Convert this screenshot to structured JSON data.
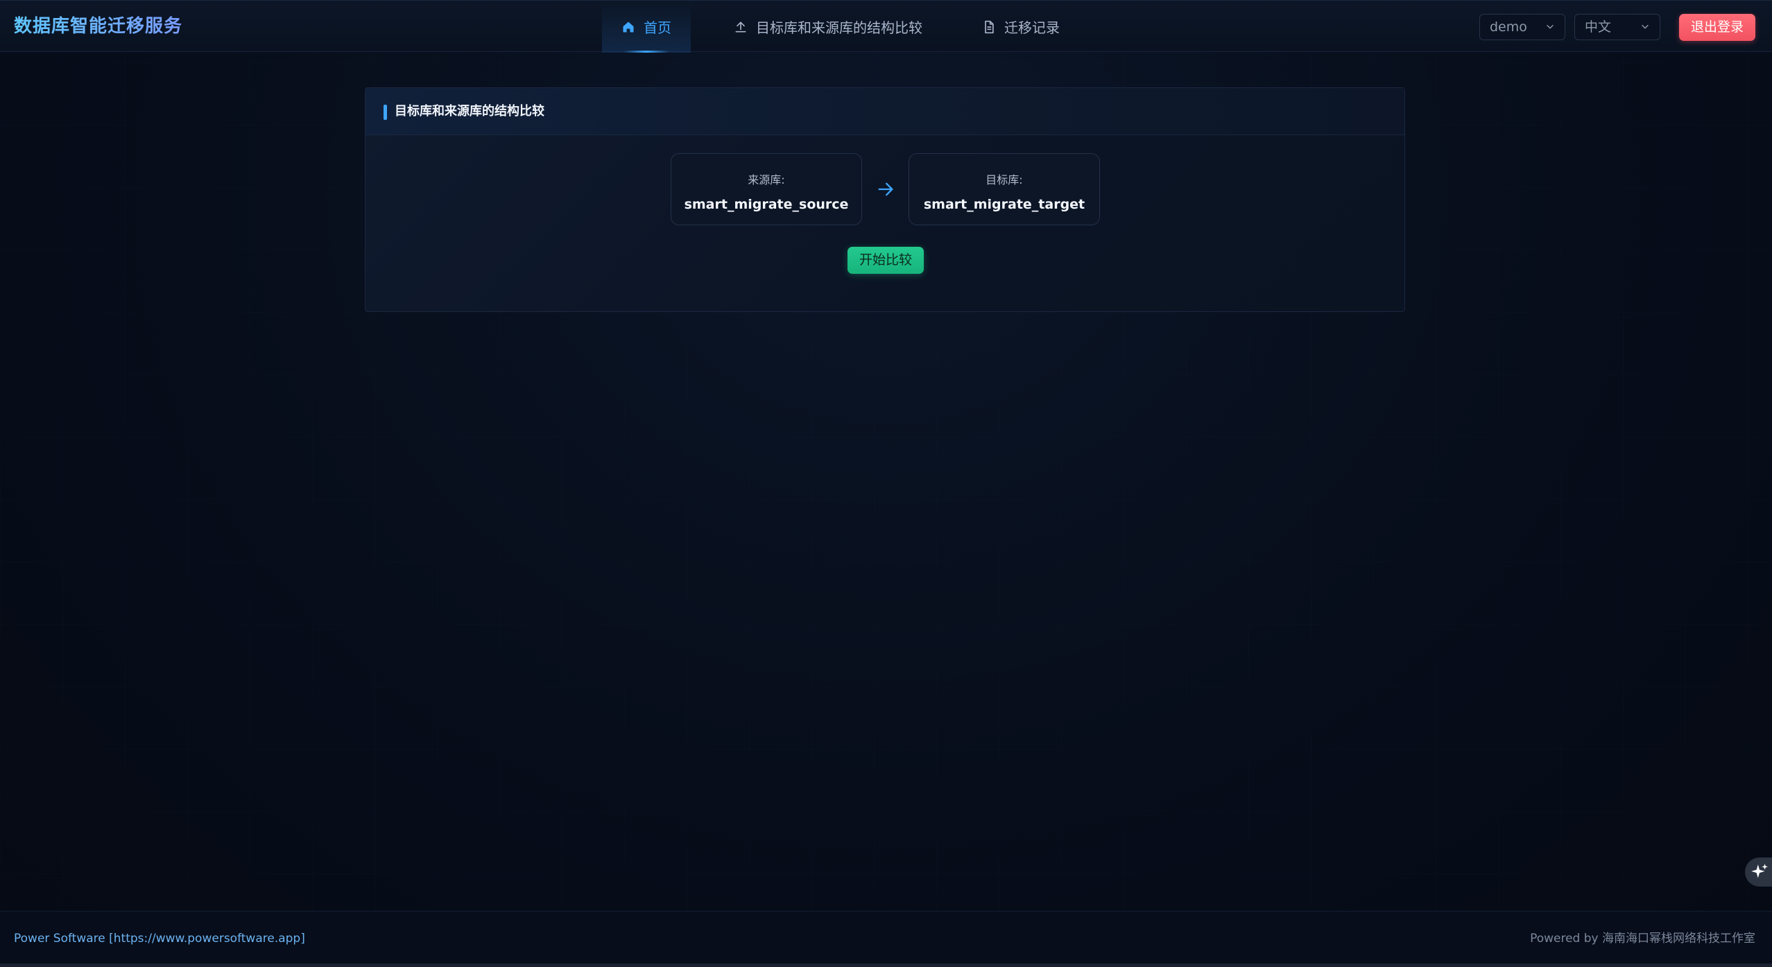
{
  "header": {
    "brand": "数据库智能迁移服务",
    "nav": [
      {
        "label": "首页",
        "icon": "home-icon",
        "active": true
      },
      {
        "label": "目标库和来源库的结构比较",
        "icon": "upload-icon",
        "active": false
      },
      {
        "label": "迁移记录",
        "icon": "document-icon",
        "active": false
      }
    ],
    "user_select": "demo",
    "lang_select": "中文",
    "logout_label": "退出登录"
  },
  "card": {
    "title": "目标库和来源库的结构比较",
    "source": {
      "label": "来源库:",
      "name": "smart_migrate_source"
    },
    "target": {
      "label": "目标库:",
      "name": "smart_migrate_target"
    },
    "arrow_icon": "arrow-right-icon",
    "compare_label": "开始比较"
  },
  "fab": {
    "icon": "sparkle-icon"
  },
  "footer": {
    "left": "Power Software [https://www.powersoftware.app]",
    "right": "Powered by 海南海口幂栈网络科技工作室"
  },
  "colors": {
    "accent": "#3fa6ff",
    "danger": "#f25260",
    "success": "#23c98e",
    "background": "#060b17"
  }
}
